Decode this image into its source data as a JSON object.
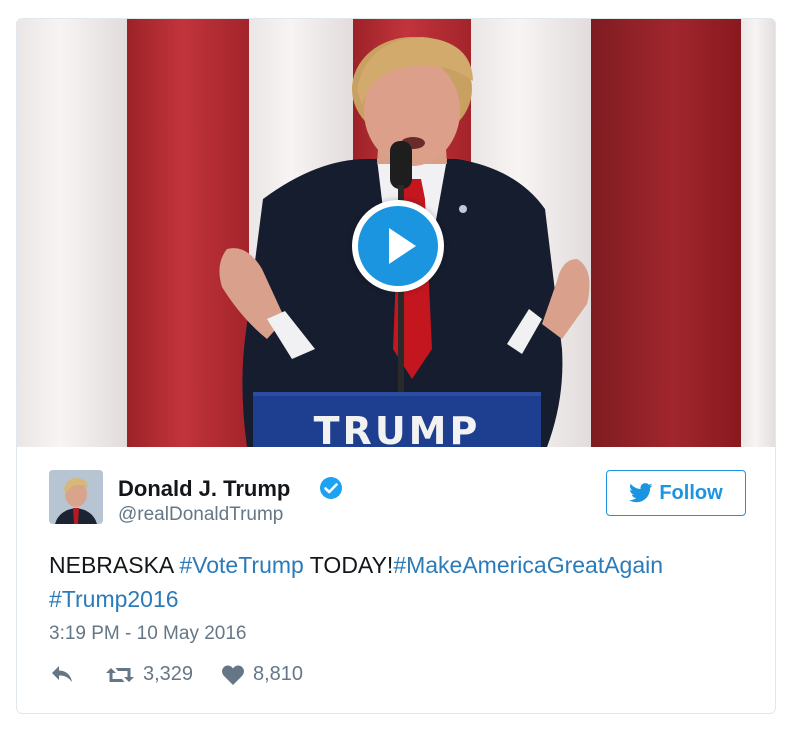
{
  "video": {
    "podium_text": "TRUMP"
  },
  "author": {
    "name": "Donald J. Trump",
    "handle": "@realDonaldTrump"
  },
  "follow_label": "Follow",
  "tweet": {
    "segments": [
      {
        "text": "NEBRASKA ",
        "type": "text"
      },
      {
        "text": "#VoteTrump",
        "type": "hashtag"
      },
      {
        "text": " TODAY!",
        "type": "text"
      },
      {
        "text": "#MakeAmericaGreatAgain",
        "type": "hashtag"
      },
      {
        "text": " ",
        "type": "text"
      },
      {
        "text": "#Trump2016",
        "type": "hashtag"
      }
    ]
  },
  "timestamp": "3:19 PM - 10 May 2016",
  "actions": {
    "retweets": "3,329",
    "likes": "8,810"
  },
  "colors": {
    "accent": "#1b95e0",
    "hashtag": "#2b7bb9",
    "muted": "#657786",
    "text": "#14171a",
    "border": "#e1e8ed"
  },
  "icons": {
    "play": "play-icon",
    "verified": "verified-badge-icon",
    "follow": "twitter-bird-icon",
    "reply": "reply-icon",
    "retweet": "retweet-icon",
    "like": "heart-icon"
  }
}
